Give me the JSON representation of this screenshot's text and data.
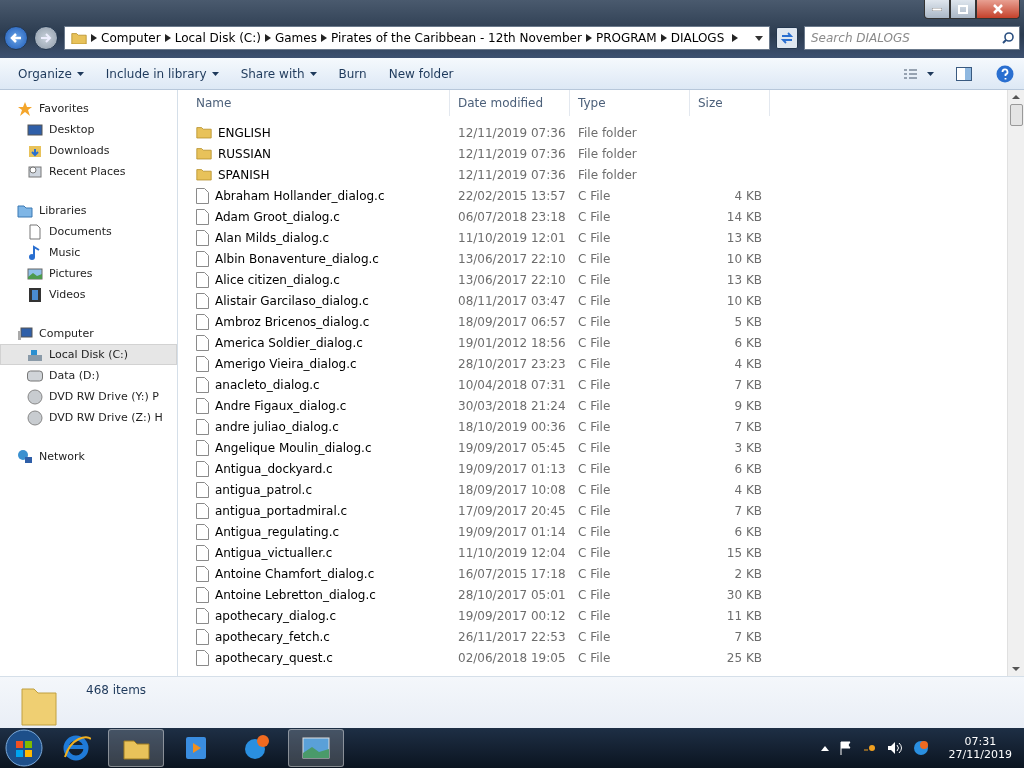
{
  "address_bar": {
    "crumbs": [
      "Computer",
      "Local Disk (C:)",
      "Games",
      "Pirates of the Caribbean - 12th November",
      "PROGRAM",
      "DIALOGS"
    ]
  },
  "search": {
    "placeholder": "Search DIALOGS"
  },
  "toolbar": {
    "commands": [
      {
        "label": "Organize",
        "dropdown": true
      },
      {
        "label": "Include in library",
        "dropdown": true
      },
      {
        "label": "Share with",
        "dropdown": true
      },
      {
        "label": "Burn",
        "dropdown": false
      },
      {
        "label": "New folder",
        "dropdown": false
      }
    ]
  },
  "sidebar": {
    "groups": [
      {
        "label": "Favorites",
        "kind": "favorites",
        "items": [
          {
            "label": "Desktop",
            "kind": "desktop",
            "selected": false
          },
          {
            "label": "Downloads",
            "kind": "downloads",
            "selected": false
          },
          {
            "label": "Recent Places",
            "kind": "recent",
            "selected": false
          }
        ]
      },
      {
        "label": "Libraries",
        "kind": "libraries",
        "items": [
          {
            "label": "Documents",
            "kind": "documents",
            "selected": false
          },
          {
            "label": "Music",
            "kind": "music",
            "selected": false
          },
          {
            "label": "Pictures",
            "kind": "pictures",
            "selected": false
          },
          {
            "label": "Videos",
            "kind": "videos",
            "selected": false
          }
        ]
      },
      {
        "label": "Computer",
        "kind": "computer",
        "items": [
          {
            "label": "Local Disk (C:)",
            "kind": "disk",
            "selected": true
          },
          {
            "label": "Data (D:)",
            "kind": "drive",
            "selected": false
          },
          {
            "label": "DVD RW Drive (Y:) P",
            "kind": "dvd",
            "selected": false
          },
          {
            "label": "DVD RW Drive (Z:) H",
            "kind": "dvd",
            "selected": false
          }
        ]
      },
      {
        "label": "Network",
        "kind": "network"
      }
    ]
  },
  "file_list": {
    "columns": [
      "Name",
      "Date modified",
      "Type",
      "Size"
    ],
    "rows": [
      {
        "kind": "folder",
        "name": "ENGLISH",
        "date": "12/11/2019 07:36",
        "type": "File folder"
      },
      {
        "kind": "folder",
        "name": "RUSSIAN",
        "date": "12/11/2019 07:36",
        "type": "File folder"
      },
      {
        "kind": "folder",
        "name": "SPANISH",
        "date": "12/11/2019 07:36",
        "type": "File folder"
      },
      {
        "kind": "file",
        "name": "Abraham Hollander_dialog.c",
        "date": "22/02/2015 13:57",
        "type": "C File",
        "size": "4 KB"
      },
      {
        "kind": "file",
        "name": "Adam Groot_dialog.c",
        "date": "06/07/2018 23:18",
        "type": "C File",
        "size": "14 KB"
      },
      {
        "kind": "file",
        "name": "Alan Milds_dialog.c",
        "date": "11/10/2019 12:01",
        "type": "C File",
        "size": "13 KB"
      },
      {
        "kind": "file",
        "name": "Albin Bonaventure_dialog.c",
        "date": "13/06/2017 22:10",
        "type": "C File",
        "size": "10 KB"
      },
      {
        "kind": "file",
        "name": "Alice citizen_dialog.c",
        "date": "13/06/2017 22:10",
        "type": "C File",
        "size": "13 KB"
      },
      {
        "kind": "file",
        "name": "Alistair Garcilaso_dialog.c",
        "date": "08/11/2017 03:47",
        "type": "C File",
        "size": "10 KB"
      },
      {
        "kind": "file",
        "name": "Ambroz Bricenos_dialog.c",
        "date": "18/09/2017 06:57",
        "type": "C File",
        "size": "5 KB"
      },
      {
        "kind": "file",
        "name": "America Soldier_dialog.c",
        "date": "19/01/2012 18:56",
        "type": "C File",
        "size": "6 KB"
      },
      {
        "kind": "file",
        "name": "Amerigo Vieira_dialog.c",
        "date": "28/10/2017 23:23",
        "type": "C File",
        "size": "4 KB"
      },
      {
        "kind": "file",
        "name": "anacleto_dialog.c",
        "date": "10/04/2018 07:31",
        "type": "C File",
        "size": "7 KB"
      },
      {
        "kind": "file",
        "name": "Andre Figaux_dialog.c",
        "date": "30/03/2018 21:24",
        "type": "C File",
        "size": "9 KB"
      },
      {
        "kind": "file",
        "name": "andre juliao_dialog.c",
        "date": "18/10/2019 00:36",
        "type": "C File",
        "size": "7 KB"
      },
      {
        "kind": "file",
        "name": "Angelique Moulin_dialog.c",
        "date": "19/09/2017 05:45",
        "type": "C File",
        "size": "3 KB"
      },
      {
        "kind": "file",
        "name": "Antigua_dockyard.c",
        "date": "19/09/2017 01:13",
        "type": "C File",
        "size": "6 KB"
      },
      {
        "kind": "file",
        "name": "antigua_patrol.c",
        "date": "18/09/2017 10:08",
        "type": "C File",
        "size": "4 KB"
      },
      {
        "kind": "file",
        "name": "antigua_portadmiral.c",
        "date": "17/09/2017 20:45",
        "type": "C File",
        "size": "7 KB"
      },
      {
        "kind": "file",
        "name": "Antigua_regulating.c",
        "date": "19/09/2017 01:14",
        "type": "C File",
        "size": "6 KB"
      },
      {
        "kind": "file",
        "name": "Antigua_victualler.c",
        "date": "11/10/2019 12:04",
        "type": "C File",
        "size": "15 KB"
      },
      {
        "kind": "file",
        "name": "Antoine Chamfort_dialog.c",
        "date": "16/07/2015 17:18",
        "type": "C File",
        "size": "2 KB"
      },
      {
        "kind": "file",
        "name": "Antoine Lebretton_dialog.c",
        "date": "28/10/2017 05:01",
        "type": "C File",
        "size": "30 KB"
      },
      {
        "kind": "file",
        "name": "apothecary_dialog.c",
        "date": "19/09/2017 00:12",
        "type": "C File",
        "size": "11 KB"
      },
      {
        "kind": "file",
        "name": "apothecary_fetch.c",
        "date": "26/11/2017 22:53",
        "type": "C File",
        "size": "7 KB"
      },
      {
        "kind": "file",
        "name": "apothecary_quest.c",
        "date": "02/06/2018 19:05",
        "type": "C File",
        "size": "25 KB"
      }
    ]
  },
  "details_pane": {
    "item_count": "468 items"
  },
  "taskbar": {
    "apps": [
      {
        "kind": "browser",
        "open": false
      },
      {
        "kind": "explorer",
        "open": true
      },
      {
        "kind": "media",
        "open": false
      },
      {
        "kind": "chat",
        "open": false
      },
      {
        "kind": "photos",
        "open": true
      }
    ],
    "clock": {
      "time": "07:31",
      "date": "27/11/2019"
    }
  }
}
